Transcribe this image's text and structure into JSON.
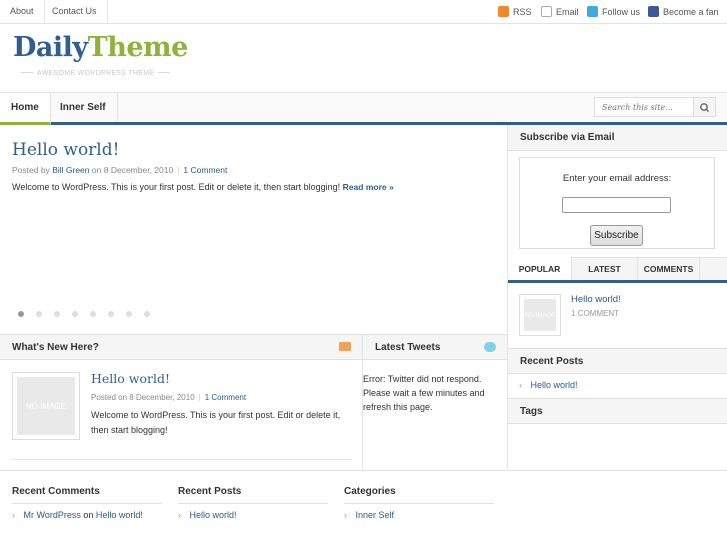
{
  "topnav": {
    "items": [
      "About",
      "Contact Us"
    ]
  },
  "social": {
    "rss": "RSS",
    "email": "Email",
    "twitter": "Follow us",
    "facebook": "Become a fan"
  },
  "logo": {
    "part1": "Daily",
    "part2": "Theme",
    "tagline": "AWESOME WORDPRESS THEME"
  },
  "mainnav": {
    "items": [
      "Home",
      "Inner Self"
    ]
  },
  "search": {
    "placeholder": "Search this site..."
  },
  "featured": {
    "title": "Hello world!",
    "posted_by": "Posted by",
    "author": "Bill Green",
    "on": "on",
    "date": "8 December, 2010",
    "comments": "1 Comment",
    "excerpt": "Welcome to WordPress. This is your first post. Edit or delete it, then start blogging!",
    "read_more": "Read more »",
    "slide_count": 8,
    "active_slide": 1
  },
  "whats_new": {
    "heading": "What's New Here?",
    "image_label": "NO IMAGE",
    "title": "Hello world!",
    "posted_on": "Posted on",
    "date": "8 December, 2010",
    "comments": "1 Comment",
    "excerpt": "Welcome to WordPress. This is your first post. Edit or delete it, then start blogging!"
  },
  "tweets": {
    "heading": "Latest Tweets",
    "error": "Error: Twitter did not respond. Please wait a few minutes and refresh this page."
  },
  "subscribe": {
    "heading": "Subscribe via Email",
    "label": "Enter your email address:",
    "button": "Subscribe"
  },
  "tabs": {
    "items": [
      "POPULAR",
      "LATEST",
      "COMMENTS"
    ],
    "active": "POPULAR",
    "popular_image_label": "NO IMAGE",
    "popular_title": "Hello world!",
    "popular_comments": "1 COMMENT"
  },
  "sidebar_recent_posts": {
    "heading": "Recent Posts",
    "items": [
      "Hello world!"
    ]
  },
  "sidebar_tags": {
    "heading": "Tags"
  },
  "footer": {
    "recent_comments": {
      "heading": "Recent Comments",
      "author": "Mr WordPress",
      "on": "on",
      "post": "Hello world!"
    },
    "recent_posts": {
      "heading": "Recent Posts",
      "items": [
        "Hello world!"
      ]
    },
    "categories": {
      "heading": "Categories",
      "items": [
        "Inner Self"
      ]
    }
  },
  "colors": {
    "brand_blue": "#2e5f8f",
    "brand_green": "#8db33a"
  }
}
